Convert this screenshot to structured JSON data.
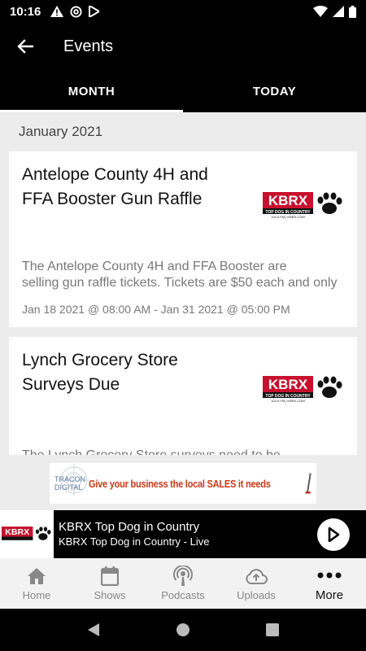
{
  "status_bar": {
    "time": "10:16"
  },
  "app_bar": {
    "title": "Events"
  },
  "tabs": [
    {
      "label": "MONTH",
      "active": true
    },
    {
      "label": "TODAY",
      "active": false
    }
  ],
  "month_header": "January 2021",
  "events": [
    {
      "title": "Antelope County 4H and FFA Booster Gun Raffle",
      "description_line1": "The Antelope County 4H and FFA Booster are",
      "description_line2": "selling gun raffle tickets.  Tickets are $50 each and only",
      "date": "Jan 18 2021 @ 08:00 AM - Jan 31 2021 @ 05:00 PM",
      "logo": {
        "text": "KBRX",
        "tagline": "TOP DOG IN COUNTRY",
        "sub": "102.9 FM | KBRX.COM"
      }
    },
    {
      "title": "Lynch Grocery Store Surveys Due",
      "description_line1": "The Lynch Grocery Store surveys need to be",
      "logo": {
        "text": "KBRX",
        "tagline": "TOP DOG IN COUNTRY",
        "sub": "102.9 FM | KBRX.COM"
      }
    }
  ],
  "ad": {
    "brand": "TRACON DIGITAL",
    "text": "Give your business the local SALES it needs"
  },
  "player": {
    "title": "KBRX Top Dog in Country",
    "subtitle": "KBRX Top Dog in Country  - Live",
    "logo_text": "KBRX"
  },
  "bottom_nav": [
    {
      "label": "Home",
      "icon": "home-icon",
      "active": false
    },
    {
      "label": "Shows",
      "icon": "calendar-icon",
      "active": false
    },
    {
      "label": "Podcasts",
      "icon": "podcast-icon",
      "active": false
    },
    {
      "label": "Uploads",
      "icon": "cloud-upload-icon",
      "active": false
    },
    {
      "label": "More",
      "icon": "more-dots-icon",
      "active": true
    }
  ],
  "colors": {
    "logo_red": "#c8102e",
    "ad_red": "#c83a1a",
    "background_gray": "#ececec"
  }
}
